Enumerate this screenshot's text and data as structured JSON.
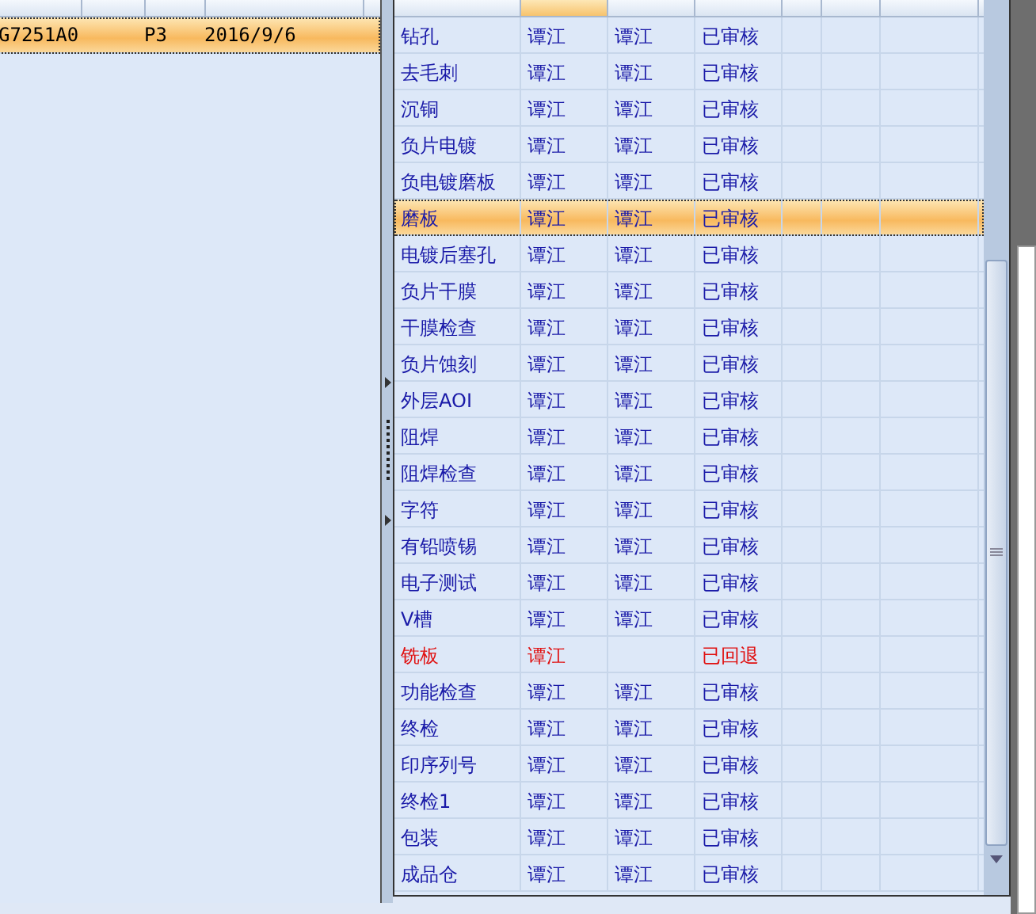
{
  "left_grid": {
    "rows": [
      {
        "cells": [
          "G7251A0",
          "",
          "P3",
          "2016/9/6"
        ],
        "selected": true
      }
    ]
  },
  "process_grid": {
    "rows": [
      {
        "name": "钻孔",
        "editor": "谭江",
        "reviewer": "谭江",
        "status": "已审核",
        "kind": "approved",
        "selected": false
      },
      {
        "name": "去毛刺",
        "editor": "谭江",
        "reviewer": "谭江",
        "status": "已审核",
        "kind": "approved",
        "selected": false
      },
      {
        "name": "沉铜",
        "editor": "谭江",
        "reviewer": "谭江",
        "status": "已审核",
        "kind": "approved",
        "selected": false
      },
      {
        "name": "负片电镀",
        "editor": "谭江",
        "reviewer": "谭江",
        "status": "已审核",
        "kind": "approved",
        "selected": false
      },
      {
        "name": "负电镀磨板",
        "editor": "谭江",
        "reviewer": "谭江",
        "status": "已审核",
        "kind": "approved",
        "selected": false
      },
      {
        "name": "磨板",
        "editor": "谭江",
        "reviewer": "谭江",
        "status": "已审核",
        "kind": "approved",
        "selected": true
      },
      {
        "name": "电镀后塞孔",
        "editor": "谭江",
        "reviewer": "谭江",
        "status": "已审核",
        "kind": "approved",
        "selected": false
      },
      {
        "name": "负片干膜",
        "editor": "谭江",
        "reviewer": "谭江",
        "status": "已审核",
        "kind": "approved",
        "selected": false
      },
      {
        "name": "干膜检查",
        "editor": "谭江",
        "reviewer": "谭江",
        "status": "已审核",
        "kind": "approved",
        "selected": false
      },
      {
        "name": "负片蚀刻",
        "editor": "谭江",
        "reviewer": "谭江",
        "status": "已审核",
        "kind": "approved",
        "selected": false
      },
      {
        "name": "外层AOI",
        "editor": "谭江",
        "reviewer": "谭江",
        "status": "已审核",
        "kind": "approved",
        "selected": false
      },
      {
        "name": "阻焊",
        "editor": "谭江",
        "reviewer": "谭江",
        "status": "已审核",
        "kind": "approved",
        "selected": false
      },
      {
        "name": "阻焊检查",
        "editor": "谭江",
        "reviewer": "谭江",
        "status": "已审核",
        "kind": "approved",
        "selected": false
      },
      {
        "name": "字符",
        "editor": "谭江",
        "reviewer": "谭江",
        "status": "已审核",
        "kind": "approved",
        "selected": false
      },
      {
        "name": "有铅喷锡",
        "editor": "谭江",
        "reviewer": "谭江",
        "status": "已审核",
        "kind": "approved",
        "selected": false
      },
      {
        "name": "电子测试",
        "editor": "谭江",
        "reviewer": "谭江",
        "status": "已审核",
        "kind": "approved",
        "selected": false
      },
      {
        "name": "V槽",
        "editor": "谭江",
        "reviewer": "谭江",
        "status": "已审核",
        "kind": "approved",
        "selected": false
      },
      {
        "name": "铣板",
        "editor": "谭江",
        "reviewer": "",
        "status": "已回退",
        "kind": "returned",
        "selected": false
      },
      {
        "name": "功能检查",
        "editor": "谭江",
        "reviewer": "谭江",
        "status": "已审核",
        "kind": "approved",
        "selected": false
      },
      {
        "name": "终检",
        "editor": "谭江",
        "reviewer": "谭江",
        "status": "已审核",
        "kind": "approved",
        "selected": false
      },
      {
        "name": "印序列号",
        "editor": "谭江",
        "reviewer": "谭江",
        "status": "已审核",
        "kind": "approved",
        "selected": false
      },
      {
        "name": "终检1",
        "editor": "谭江",
        "reviewer": "谭江",
        "status": "已审核",
        "kind": "approved",
        "selected": false
      },
      {
        "name": "包装",
        "editor": "谭江",
        "reviewer": "谭江",
        "status": "已审核",
        "kind": "approved",
        "selected": false
      },
      {
        "name": "成品仓",
        "editor": "谭江",
        "reviewer": "谭江",
        "status": "已审核",
        "kind": "approved",
        "selected": false
      }
    ]
  }
}
